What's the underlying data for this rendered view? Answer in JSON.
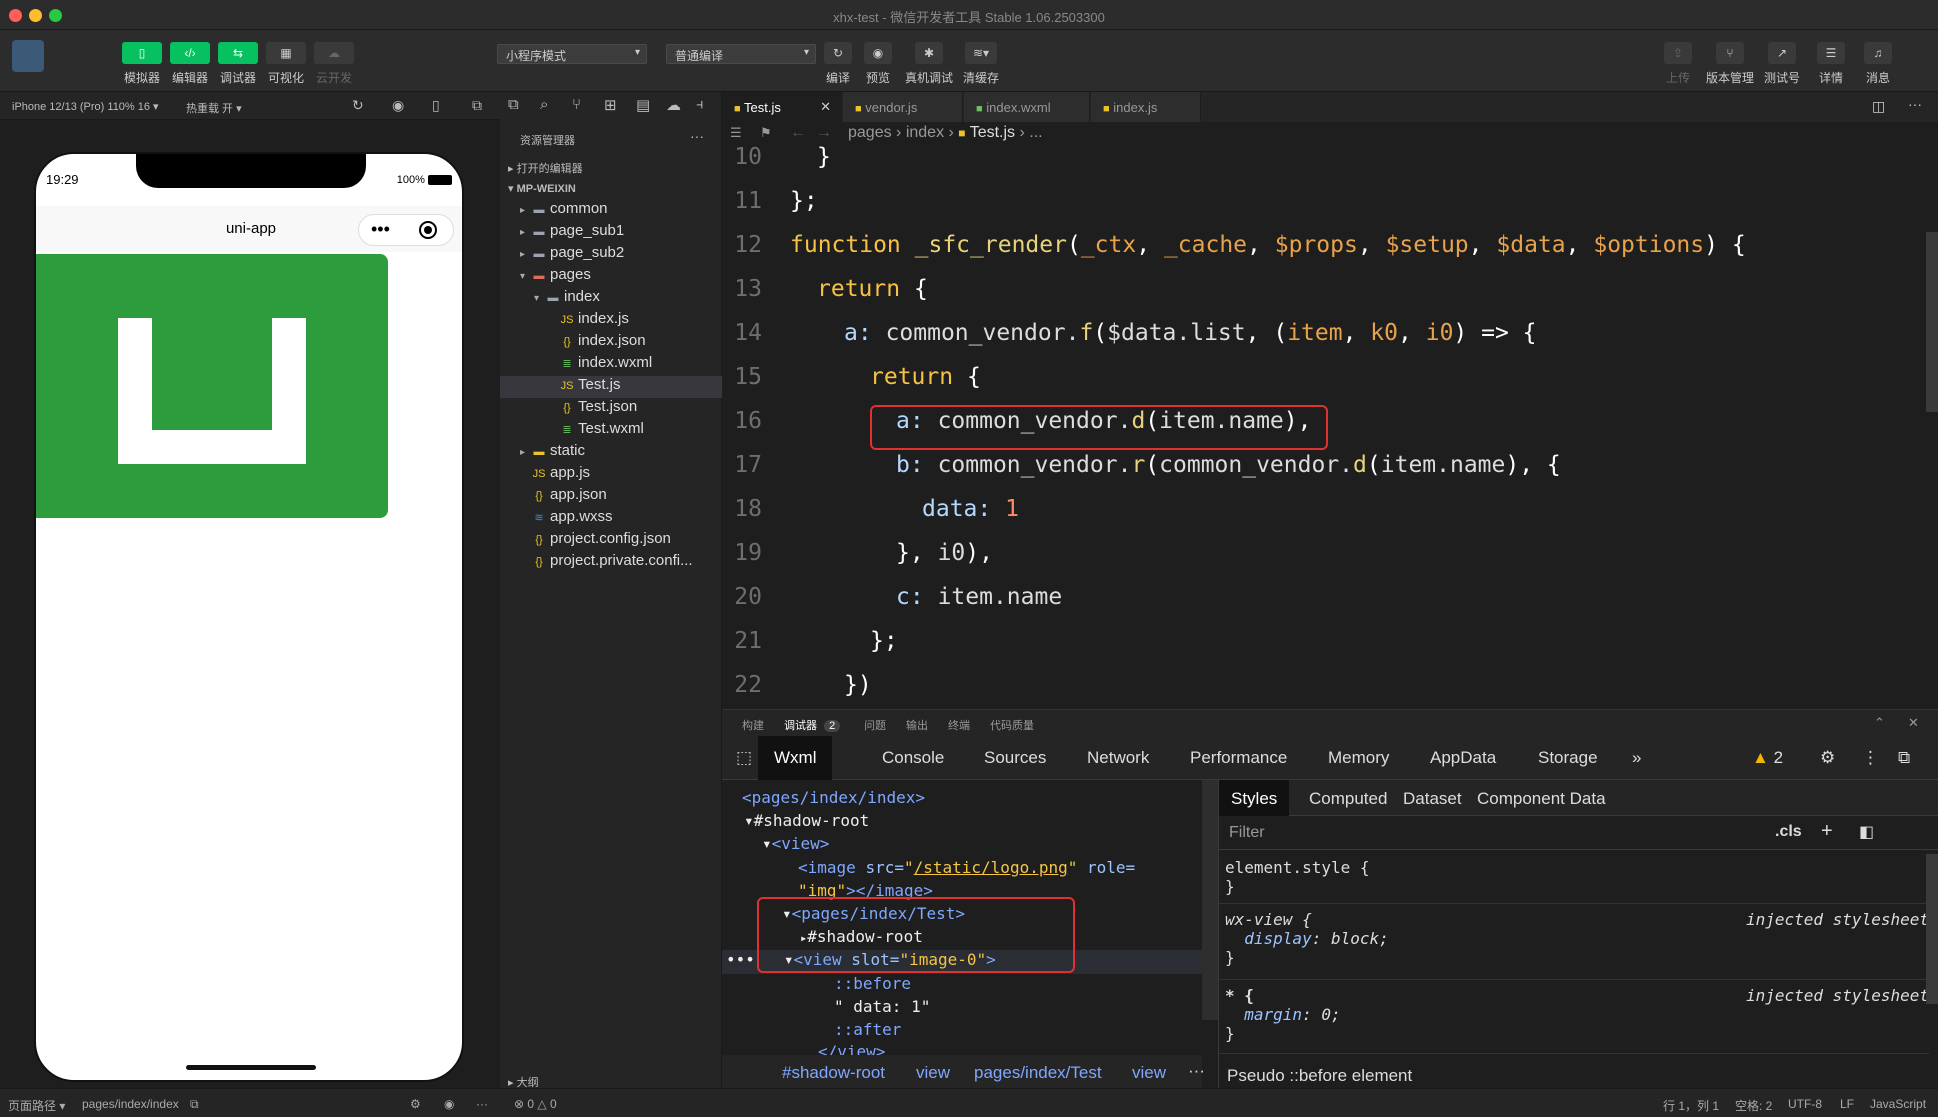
{
  "window": {
    "title": "xhx-test - 微信开发者工具 Stable 1.06.2503300"
  },
  "toolbar": {
    "left_buttons": [
      "模拟器",
      "编辑器",
      "调试器",
      "可视化",
      "云开发"
    ],
    "mode_select": "小程序模式",
    "compile_select": "普通编译",
    "mid_buttons": [
      "编译",
      "预览",
      "真机调试",
      "清缓存"
    ],
    "right_buttons": [
      "上传",
      "版本管理",
      "测试号",
      "详情",
      "消息"
    ]
  },
  "simulator": {
    "device": "iPhone 12/13 (Pro) 110% 16 ▾",
    "hot_reload": "热重载 开 ▾",
    "time": "19:29",
    "battery": "100%",
    "nav_title": "uni-app"
  },
  "explorer": {
    "title": "资源管理器",
    "open_editors": "打开的编辑器",
    "root": "MP-WEIXIN",
    "items": [
      {
        "label": "common",
        "type": "folder",
        "depth": 1
      },
      {
        "label": "page_sub1",
        "type": "folder",
        "depth": 1
      },
      {
        "label": "page_sub2",
        "type": "folder",
        "depth": 1
      },
      {
        "label": "pages",
        "type": "folder-open",
        "depth": 1
      },
      {
        "label": "index",
        "type": "folder-open",
        "depth": 2
      },
      {
        "label": "index.js",
        "type": "js",
        "depth": 3
      },
      {
        "label": "index.json",
        "type": "json",
        "depth": 3
      },
      {
        "label": "index.wxml",
        "type": "wxml",
        "depth": 3
      },
      {
        "label": "Test.js",
        "type": "js",
        "depth": 3
      },
      {
        "label": "Test.json",
        "type": "json",
        "depth": 3
      },
      {
        "label": "Test.wxml",
        "type": "wxml",
        "depth": 3
      },
      {
        "label": "static",
        "type": "folder",
        "depth": 1
      },
      {
        "label": "app.js",
        "type": "js",
        "depth": 1
      },
      {
        "label": "app.json",
        "type": "json",
        "depth": 1
      },
      {
        "label": "app.wxss",
        "type": "wxss",
        "depth": 1
      },
      {
        "label": "project.config.json",
        "type": "json",
        "depth": 1
      },
      {
        "label": "project.private.confi...",
        "type": "json",
        "depth": 1
      }
    ],
    "outline": "大纲",
    "active_index": 8
  },
  "editor": {
    "tabs": [
      "Test.js",
      "vendor.js",
      "index.wxml",
      "index.js"
    ],
    "breadcrumb": [
      "pages",
      "index",
      "Test.js",
      "..."
    ],
    "line_numbers": [
      "10",
      "11",
      "12",
      "13",
      "14",
      "15",
      "16",
      "17",
      "18",
      "19",
      "20",
      "21",
      "22"
    ]
  },
  "panel": {
    "tabs": [
      "构建",
      "调试器",
      "问题",
      "输出",
      "终端",
      "代码质量"
    ],
    "debugger_badge": "2",
    "devtools_tabs": [
      "Wxml",
      "Console",
      "Sources",
      "Network",
      "Performance",
      "Memory",
      "AppData",
      "Storage"
    ],
    "warnings": "2",
    "wxml_crumbs": [
      "#shadow-root",
      "view",
      "pages/index/Test",
      "view"
    ],
    "style_tabs": [
      "Styles",
      "Computed",
      "Dataset",
      "Component Data"
    ],
    "filter_placeholder": "Filter",
    "cls": ".cls",
    "pseudo": "Pseudo ::before element"
  },
  "statusbar": {
    "page_path_label": "页面路径 ▾",
    "page_path": "pages/index/index",
    "problems": "⊗ 0 △ 0",
    "cursor": "行 1，列 1",
    "spaces": "空格: 2",
    "encoding": "UTF-8",
    "eol": "LF",
    "language": "JavaScript"
  }
}
